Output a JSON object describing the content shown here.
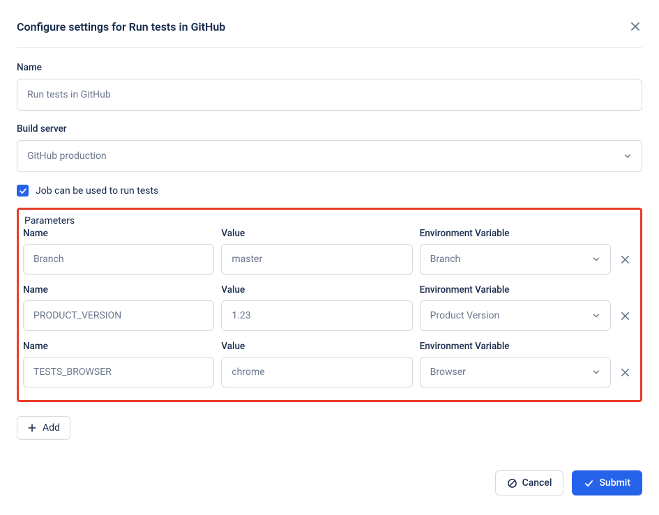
{
  "header": {
    "title": "Configure settings for Run tests in GitHub"
  },
  "name_field": {
    "label": "Name",
    "value": "Run tests in GitHub"
  },
  "build_server": {
    "label": "Build server",
    "value": "GitHub production"
  },
  "run_tests_checkbox": {
    "checked": true,
    "label": "Job can be used to run tests"
  },
  "parameters": {
    "title": "Parameters",
    "col_name": "Name",
    "col_value": "Value",
    "col_env": "Environment Variable",
    "rows": [
      {
        "name": "Branch",
        "value": "master",
        "env": "Branch"
      },
      {
        "name": "PRODUCT_VERSION",
        "value": "1.23",
        "env": "Product Version"
      },
      {
        "name": "TESTS_BROWSER",
        "value": "chrome",
        "env": "Browser"
      }
    ]
  },
  "add_button": "Add",
  "footer": {
    "cancel": "Cancel",
    "submit": "Submit"
  }
}
